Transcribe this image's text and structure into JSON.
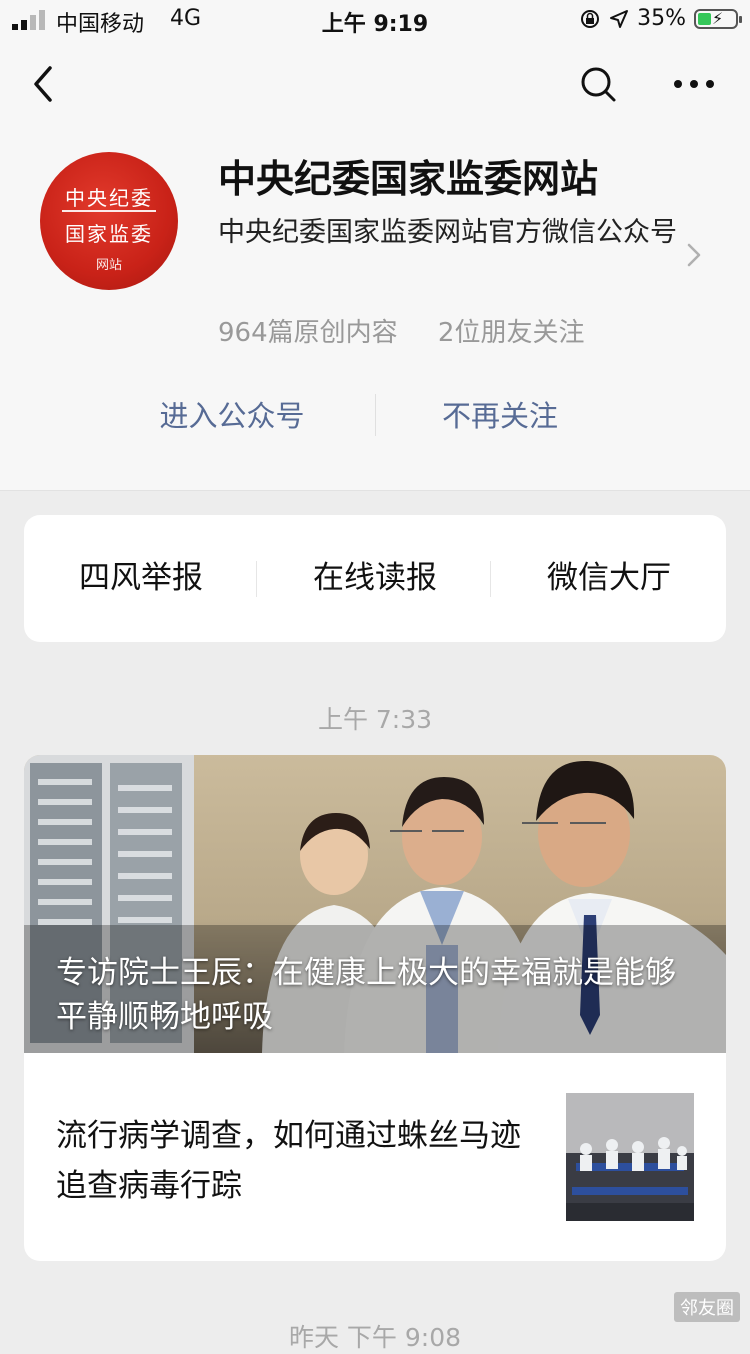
{
  "status_bar": {
    "carrier": "中国移动",
    "network": "4G",
    "time": "上午 9:19",
    "battery": "35%",
    "battery_level": 0.35,
    "icons": [
      "signal-icon",
      "orientation-lock-icon",
      "location-icon",
      "battery-icon"
    ]
  },
  "nav": {
    "back_icon": "back-icon",
    "search_icon": "search-icon",
    "more_icon": "more-icon"
  },
  "account": {
    "logo_text": {
      "line1": "中央纪委",
      "line2": "国家监委",
      "line3": "网站"
    },
    "name": "中央纪委国家监委网站",
    "description": "中央纪委国家监委网站官方微信公众号",
    "original_count": "964篇原创内容",
    "friends_following": "2位朋友关注"
  },
  "actions": {
    "enter": "进入公众号",
    "unfollow": "不再关注"
  },
  "menu": [
    {
      "label": "四风举报"
    },
    {
      "label": "在线读报"
    },
    {
      "label": "微信大厅"
    }
  ],
  "feed": {
    "time_1": "上午 7:33",
    "main_article_title": "专访院士王辰：在健康上极大的幸福就是能够平静顺畅地呼吸",
    "sub_article_title": "流行病学调查，如何通过蛛丝马迹追查病毒行踪",
    "time_2": "昨天 下午 9:08"
  },
  "corner_tag": "邻友圈",
  "colors": {
    "link": "#576b95",
    "logo_red": "#c92218",
    "background": "#ededed"
  }
}
